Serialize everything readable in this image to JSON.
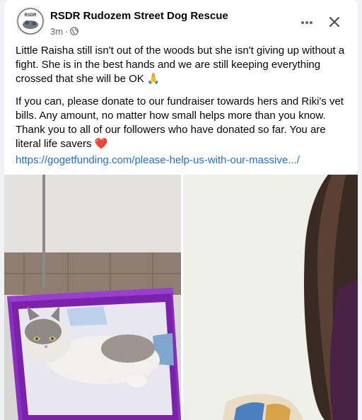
{
  "post": {
    "page_name": "RSDR Rudozem Street Dog Rescue",
    "avatar_text": "RSDR",
    "time": "3m",
    "separator": "·",
    "privacy_icon": "globe-icon",
    "menu_icon": "more-dots-icon",
    "close_icon": "close-icon",
    "paragraphs": [
      "Little Raisha still isn't out of the woods but she isn't giving up without a fight. She is in the best hands and we are still keeping everything crossed that she will be OK 🙏",
      "If you can, please donate to our fundraiser towards hers and Riki's vet bills. Any amount, no matter how small helps more than you know. Thank you to all of our followers who have donated so far. You are literal life savers ❤️"
    ],
    "link": "https://gogetfunding.com/please-help-us-with-our-massive.../"
  },
  "colors": {
    "link": "#216fdb",
    "secondary_text": "#65676b",
    "basket": "#8b2fbf"
  }
}
